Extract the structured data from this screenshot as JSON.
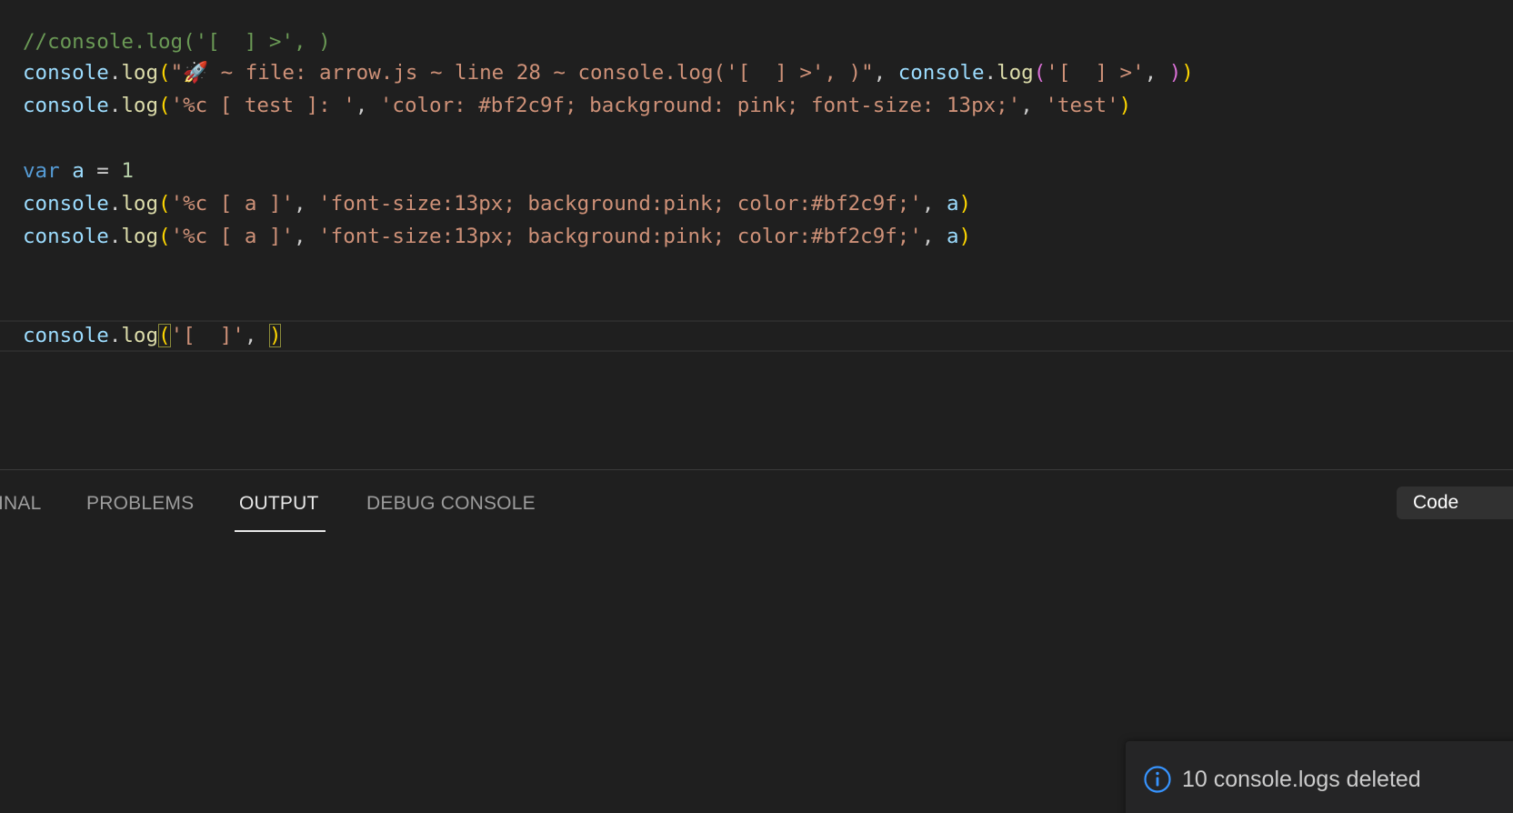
{
  "editor": {
    "lines": [
      {
        "tokens": [
          {
            "t": "//console.log('[  ] >', )",
            "c": "comment"
          }
        ]
      },
      {
        "tokens": [
          {
            "t": "console",
            "c": "obj"
          },
          {
            "t": ".",
            "c": "punc"
          },
          {
            "t": "log",
            "c": "fn"
          },
          {
            "t": "(",
            "c": "p1"
          },
          {
            "t": "\"",
            "c": "str"
          },
          {
            "t": "🚀",
            "c": "rocket"
          },
          {
            "t": " ~ file: arrow.js ~ line 28 ~ console.log('[  ] >', )\"",
            "c": "str"
          },
          {
            "t": ", ",
            "c": "punc"
          },
          {
            "t": "console",
            "c": "obj"
          },
          {
            "t": ".",
            "c": "punc"
          },
          {
            "t": "log",
            "c": "fn"
          },
          {
            "t": "(",
            "c": "p2"
          },
          {
            "t": "'[  ] >'",
            "c": "str"
          },
          {
            "t": ", ",
            "c": "punc"
          },
          {
            "t": ")",
            "c": "p2"
          },
          {
            "t": ")",
            "c": "p1"
          }
        ]
      },
      {
        "tokens": [
          {
            "t": "console",
            "c": "obj"
          },
          {
            "t": ".",
            "c": "punc"
          },
          {
            "t": "log",
            "c": "fn"
          },
          {
            "t": "(",
            "c": "p1"
          },
          {
            "t": "'%c [ test ]: '",
            "c": "str"
          },
          {
            "t": ", ",
            "c": "punc"
          },
          {
            "t": "'color: #bf2c9f; background: pink; font-size: 13px;'",
            "c": "str"
          },
          {
            "t": ", ",
            "c": "punc"
          },
          {
            "t": "'test'",
            "c": "str"
          },
          {
            "t": ")",
            "c": "p1"
          }
        ]
      },
      {
        "tokens": [
          {
            "t": "var",
            "c": "kw"
          },
          {
            "t": " ",
            "c": "punc"
          },
          {
            "t": "a",
            "c": "obj"
          },
          {
            "t": " = ",
            "c": "punc"
          },
          {
            "t": "1",
            "c": "num"
          }
        ]
      },
      {
        "tokens": [
          {
            "t": "console",
            "c": "obj"
          },
          {
            "t": ".",
            "c": "punc"
          },
          {
            "t": "log",
            "c": "fn"
          },
          {
            "t": "(",
            "c": "p1"
          },
          {
            "t": "'%c [ a ]'",
            "c": "str"
          },
          {
            "t": ", ",
            "c": "punc"
          },
          {
            "t": "'font-size:13px; background:pink; color:#bf2c9f;'",
            "c": "str"
          },
          {
            "t": ", ",
            "c": "punc"
          },
          {
            "t": "a",
            "c": "obj"
          },
          {
            "t": ")",
            "c": "p1"
          }
        ]
      },
      {
        "tokens": [
          {
            "t": "console",
            "c": "obj"
          },
          {
            "t": ".",
            "c": "punc"
          },
          {
            "t": "log",
            "c": "fn"
          },
          {
            "t": "(",
            "c": "p1"
          },
          {
            "t": "'%c [ a ]'",
            "c": "str"
          },
          {
            "t": ", ",
            "c": "punc"
          },
          {
            "t": "'font-size:13px; background:pink; color:#bf2c9f;'",
            "c": "str"
          },
          {
            "t": ", ",
            "c": "punc"
          },
          {
            "t": "a",
            "c": "obj"
          },
          {
            "t": ")",
            "c": "p1"
          }
        ]
      },
      {
        "tokens": [
          {
            "t": "console",
            "c": "obj"
          },
          {
            "t": ".",
            "c": "punc"
          },
          {
            "t": "log",
            "c": "fn"
          },
          {
            "t": "(",
            "c": "p1",
            "m": true
          },
          {
            "t": "'[  ]'",
            "c": "str"
          },
          {
            "t": ", ",
            "c": "punc"
          },
          {
            "t": ")",
            "c": "p1",
            "m": true
          }
        ]
      }
    ]
  },
  "panel": {
    "tabs": {
      "terminal": "INAL",
      "problems": "PROBLEMS",
      "output": "OUTPUT",
      "debug_console": "DEBUG CONSOLE"
    },
    "output_channel": "Code"
  },
  "notification": {
    "message": "10 console.logs deleted",
    "icon": "info-icon"
  },
  "colors": {
    "background": "#1f1f1f",
    "comment": "#6a9955",
    "string": "#ce9178",
    "keyword": "#569cd6",
    "variable": "#9cdcfe",
    "function": "#dcdcaa",
    "number": "#b5cea8",
    "bracket_1": "#ffd700",
    "bracket_2": "#da70d6",
    "info": "#3794ff"
  }
}
